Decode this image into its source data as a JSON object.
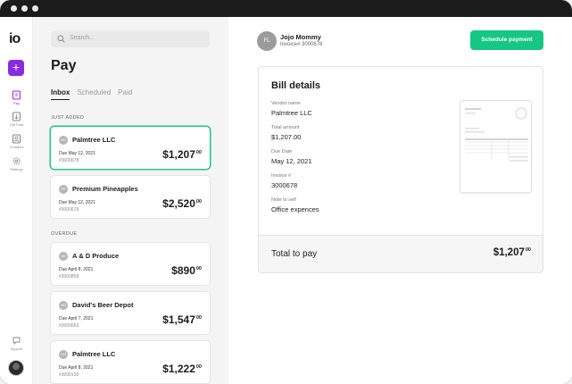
{
  "app": {
    "logo_text": "io"
  },
  "rail": {
    "add_label": "+",
    "items": [
      {
        "label": "Pay",
        "icon": "pay-icon",
        "active": true
      },
      {
        "label": "Get Paid",
        "icon": "get-paid-icon",
        "active": false
      },
      {
        "label": "Contacts",
        "icon": "contacts-icon",
        "active": false
      },
      {
        "label": "Settings",
        "icon": "gear-icon",
        "active": false
      }
    ],
    "support_label": "Support"
  },
  "list": {
    "search_placeholder": "Search...",
    "title": "Pay",
    "tabs": [
      {
        "label": "Inbox",
        "active": true
      },
      {
        "label": "Scheduled",
        "active": false
      },
      {
        "label": "Paid",
        "active": false
      }
    ],
    "sections": [
      {
        "label": "JUST ADDED"
      },
      {
        "label": "OVERDUE"
      }
    ],
    "bills": [
      {
        "initials": "NO",
        "vendor": "Palmtree LLC",
        "due": "Due  May 12, 2021",
        "invoice": "#3000678",
        "amount_main": "$1,207",
        "amount_cents": "00",
        "selected": true
      },
      {
        "initials": "PP",
        "vendor": "Premium Pineapples",
        "due": "Due  May 12, 2021",
        "invoice": "#3000678",
        "amount_main": "$2,520",
        "amount_cents": "00",
        "selected": false
      },
      {
        "initials": "NO",
        "vendor": "A & D Produce",
        "due": "Due  April 8, 2021",
        "invoice": "#3000858",
        "amount_main": "$890",
        "amount_cents": "00",
        "selected": false
      },
      {
        "initials": "NO",
        "vendor": "David's Beer Depot",
        "due": "Due  April 7, 2021",
        "invoice": "#3000663",
        "amount_main": "$1,547",
        "amount_cents": "00",
        "selected": false
      },
      {
        "initials": "NO",
        "vendor": "Palmtree LLC",
        "due": "Due  April 8, 2021",
        "invoice": "#3000158",
        "amount_main": "$1,222",
        "amount_cents": "00",
        "selected": false
      }
    ]
  },
  "detail": {
    "payer_initials": "FL",
    "payer_name": "Jojo Mommy",
    "payer_invoice": "Invoice# 3000678",
    "schedule_button": "Schedule payment",
    "card_title": "Bill details",
    "fields": [
      {
        "label": "Vendor name",
        "value": "Palmtree LLC"
      },
      {
        "label": "Total amount",
        "value": "$1,207.00"
      },
      {
        "label": "Due Date",
        "value": "May 12, 2021"
      },
      {
        "label": "Invoice #",
        "value": "3000678"
      },
      {
        "label": "Note to self",
        "value": "Office expences"
      }
    ],
    "total_label": "Total to pay",
    "total_main": "$1,207",
    "total_cents": "00"
  },
  "colors": {
    "accent": "#8a2be2",
    "success": "#16c784",
    "selected_border": "#1dc68c"
  }
}
